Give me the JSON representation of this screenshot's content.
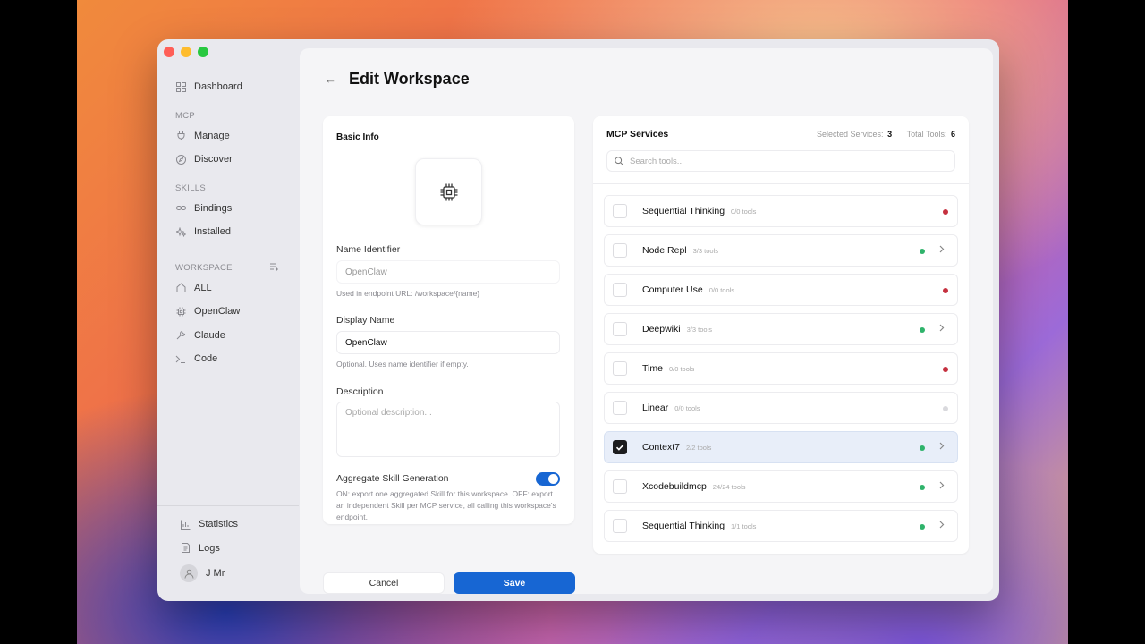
{
  "sidebar": {
    "dashboard": "Dashboard",
    "mcp_section": "MCP",
    "manage": "Manage",
    "discover": "Discover",
    "skills_section": "SKILLS",
    "bindings": "Bindings",
    "installed": "Installed",
    "workspace_section": "WORKSPACE",
    "workspaces": [
      "ALL",
      "OpenClaw",
      "Claude",
      "Code"
    ],
    "statistics": "Statistics",
    "logs": "Logs",
    "user": "J Mr"
  },
  "header": {
    "title": "Edit Workspace"
  },
  "basic_info": {
    "title": "Basic Info",
    "name_label": "Name Identifier",
    "name_value": "OpenClaw",
    "name_hint": "Used in endpoint URL: /workspace/{name}",
    "display_label": "Display Name",
    "display_value": "OpenClaw",
    "display_hint": "Optional. Uses name identifier if empty.",
    "description_label": "Description",
    "description_placeholder": "Optional description...",
    "aggregate_label": "Aggregate Skill Generation",
    "aggregate_on": true,
    "aggregate_hint": "ON: export one aggregated Skill for this workspace. OFF: export an independent Skill per MCP service, all calling this workspace's endpoint."
  },
  "actions": {
    "cancel": "Cancel",
    "save": "Save"
  },
  "mcp": {
    "title": "MCP Services",
    "selected_label": "Selected Services:",
    "selected_count": "3",
    "total_label": "Total Tools:",
    "total_count": "6",
    "search_placeholder": "Search tools...",
    "services": [
      {
        "name": "Sequential Thinking",
        "tools": "0/0 tools",
        "status": "red",
        "checked": false,
        "expandable": false
      },
      {
        "name": "Node Repl",
        "tools": "3/3 tools",
        "status": "green",
        "checked": false,
        "expandable": true
      },
      {
        "name": "Computer Use",
        "tools": "0/0 tools",
        "status": "red",
        "checked": false,
        "expandable": false
      },
      {
        "name": "Deepwiki",
        "tools": "3/3 tools",
        "status": "green",
        "checked": false,
        "expandable": true
      },
      {
        "name": "Time",
        "tools": "0/0 tools",
        "status": "red",
        "checked": false,
        "expandable": false
      },
      {
        "name": "Linear",
        "tools": "0/0 tools",
        "status": "gray",
        "checked": false,
        "expandable": false
      },
      {
        "name": "Context7",
        "tools": "2/2 tools",
        "status": "green",
        "checked": true,
        "expandable": true
      },
      {
        "name": "Xcodebuildmcp",
        "tools": "24/24 tools",
        "status": "green",
        "checked": false,
        "expandable": true
      },
      {
        "name": "Sequential Thinking",
        "tools": "1/1 tools",
        "status": "green",
        "checked": false,
        "expandable": true
      }
    ]
  },
  "colors": {
    "accent": "#1766d3",
    "status_green": "#2fb36b",
    "status_red": "#c5303f",
    "status_gray": "#d9d9dd"
  }
}
